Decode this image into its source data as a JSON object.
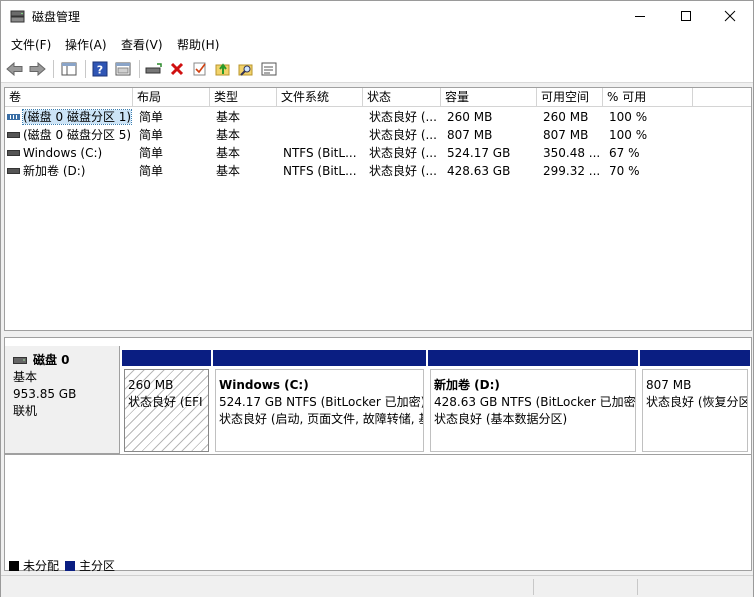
{
  "window": {
    "title": "磁盘管理"
  },
  "menu": [
    "文件(F)",
    "操作(A)",
    "查看(V)",
    "帮助(H)"
  ],
  "toolbar": [
    "back-icon",
    "forward-icon",
    "console-tree-icon",
    "help-icon",
    "show-pane-icon",
    "connect-disk-icon",
    "delete-icon",
    "check-icon",
    "up-folder-icon",
    "search-folder-icon",
    "properties-icon"
  ],
  "columns": [
    "卷",
    "布局",
    "类型",
    "文件系统",
    "状态",
    "容量",
    "可用空间",
    "% 可用"
  ],
  "volumes": [
    {
      "name": "(磁盘 0 磁盘分区 1)",
      "layout": "简单",
      "type": "基本",
      "fs": "",
      "status": "状态良好 (...",
      "capacity": "260 MB",
      "free": "260 MB",
      "pct": "100 %"
    },
    {
      "name": "(磁盘 0 磁盘分区 5)",
      "layout": "简单",
      "type": "基本",
      "fs": "",
      "status": "状态良好 (...",
      "capacity": "807 MB",
      "free": "807 MB",
      "pct": "100 %"
    },
    {
      "name": "Windows (C:)",
      "layout": "简单",
      "type": "基本",
      "fs": "NTFS (BitL...",
      "status": "状态良好 (...",
      "capacity": "524.17 GB",
      "free": "350.48 ...",
      "pct": "67 %"
    },
    {
      "name": "新加卷 (D:)",
      "layout": "简单",
      "type": "基本",
      "fs": "NTFS (BitL...",
      "status": "状态良好 (...",
      "capacity": "428.63 GB",
      "free": "299.32 ...",
      "pct": "70 %"
    }
  ],
  "disk": {
    "name": "磁盘 0",
    "type": "基本",
    "size": "953.85 GB",
    "state": "联机"
  },
  "partitions": [
    {
      "name": "",
      "line1": "260 MB",
      "line2": "状态良好 (EFI"
    },
    {
      "name": "Windows  (C:)",
      "line1": "524.17 GB NTFS (BitLocker 已加密)",
      "line2": "状态良好 (启动, 页面文件, 故障转储, 基"
    },
    {
      "name": "新加卷  (D:)",
      "line1": "428.63 GB NTFS (BitLocker 已加密)",
      "line2": "状态良好 (基本数据分区)"
    },
    {
      "name": "",
      "line1": "807 MB",
      "line2": "状态良好 (恢复分区)"
    }
  ],
  "legend": [
    {
      "label": "未分配",
      "color": "#000000"
    },
    {
      "label": "主分区",
      "color": "#0a1e82"
    }
  ]
}
